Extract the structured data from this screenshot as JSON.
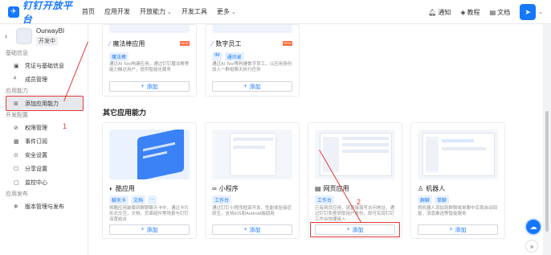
{
  "brand": {
    "name": "钉钉开放平台"
  },
  "nav": {
    "items": [
      "首页",
      "应用开发",
      "开放能力",
      "开发工具",
      "更多"
    ]
  },
  "top_right": {
    "notify": "通知",
    "tutorial": "教程",
    "docs": "文档"
  },
  "sidebar": {
    "app_name": "OurwayBI",
    "app_status": "开发中",
    "sections": [
      {
        "title": "基础信息",
        "items": [
          "凭证与基础信息",
          "成员管理"
        ]
      },
      {
        "title": "应用能力",
        "items": [
          "添加应用能力"
        ]
      },
      {
        "title": "开发配置",
        "items": [
          "权限管理",
          "事件订阅",
          "安全设置",
          "分享设置",
          "监控中心"
        ]
      },
      {
        "title": "应用发布",
        "items": [
          "版本管理与发布"
        ]
      }
    ]
  },
  "top_cards": [
    {
      "title": "魔法棒应用",
      "tags": [
        "魔法棒"
      ],
      "desc": "通过AI Tool构建应用，通过钉钉魔法棒等能力触达用户，提供智能化服务",
      "add": "添加",
      "badge": "NEW"
    },
    {
      "title": "数字员工",
      "tags": [
        "IM",
        "通讯录"
      ],
      "desc": "通过AI Tool等构建数字员工，以应用身份加入一群组聊天执行任务",
      "add": "添加",
      "badge": "NEW"
    }
  ],
  "section": {
    "title": "其它应用能力"
  },
  "cards": [
    {
      "title": "酷应用",
      "icon": "cool-app-icon",
      "tags": [
        "聊天卡",
        "文档",
        "..."
      ],
      "desc": "将酷应用装载到群聊聊天卡中，通过卡片形式交互，文档、页面组件等场景与钉钉深度结合",
      "add": "添加"
    },
    {
      "title": "小程序",
      "icon": "mini-program-icon",
      "tags": [
        "工作台"
      ],
      "desc": "通过钉钉小程序框架开发，性能体验接近原生，支持iOS和Android端调用",
      "add": "添加"
    },
    {
      "title": "网页应用",
      "icon": "web-app-icon",
      "tags": [
        "工作台"
      ],
      "desc": "已有网页应用，请直接填写访问地址，通过钉钉免登获取用户身份，即可实现钉钉工作台快捷接入",
      "add": "添加"
    },
    {
      "title": "机器人",
      "icon": "robot-icon",
      "tags": [
        "群聊",
        "单聊"
      ],
      "desc": "将机器人添加到群聊或单聊中实现自动回复、消息推送等智能服务",
      "add": "添加"
    }
  ],
  "annotations": {
    "step1": "1",
    "step2": "2"
  },
  "colors": {
    "accent": "#1677ff",
    "annotation": "#e53935"
  }
}
